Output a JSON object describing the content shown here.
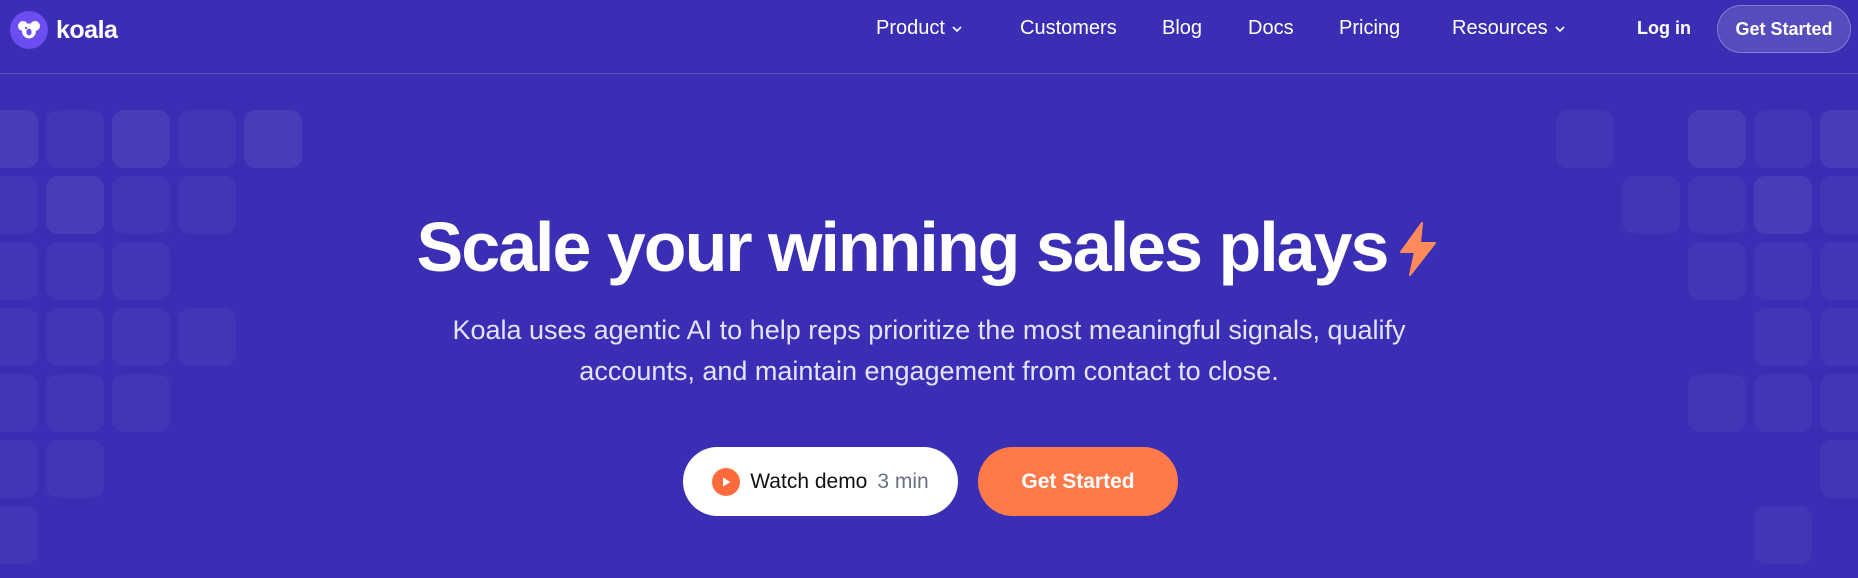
{
  "brand": {
    "name": "koala"
  },
  "nav": {
    "product": "Product",
    "customers": "Customers",
    "blog": "Blog",
    "docs": "Docs",
    "pricing": "Pricing",
    "resources": "Resources",
    "login": "Log in",
    "cta": "Get Started"
  },
  "hero": {
    "headline_pre": "Scale your ",
    "headline_bold": "winning",
    "headline_post": " sales plays",
    "subtitle": "Koala uses agentic AI to help reps prioritize the most meaningful signals, qualify accounts, and maintain engagement from contact to close.",
    "demo_label": "Watch demo",
    "demo_duration": "3 min",
    "cta": "Get Started"
  },
  "colors": {
    "background": "#3a2fb4",
    "accent": "#ff7a48",
    "logo": "#6c4df2"
  },
  "icons": [
    "koala-logo-icon",
    "chevron-down-icon",
    "lightning-bolt-icon",
    "play-icon"
  ]
}
